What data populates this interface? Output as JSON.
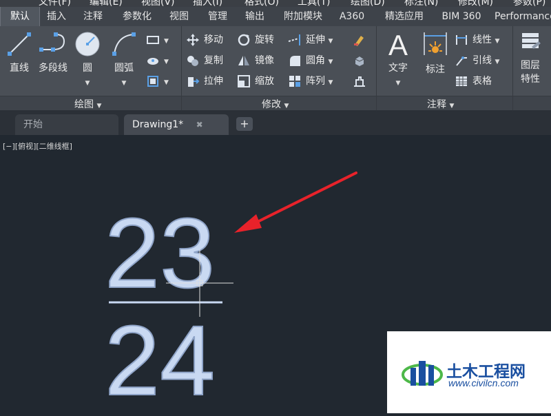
{
  "menu": {
    "items": [
      "文件(F)",
      "编辑(E)",
      "视图(V)",
      "插入(I)",
      "格式(O)",
      "工具(T)",
      "绘图(D)",
      "标注(N)",
      "修改(M)",
      "参数(P)"
    ]
  },
  "ribbon_tabs": {
    "items": [
      "默认",
      "插入",
      "注释",
      "参数化",
      "视图",
      "管理",
      "输出",
      "附加模块",
      "A360",
      "精选应用",
      "BIM 360",
      "Performance"
    ],
    "active": "默认"
  },
  "panels": {
    "draw": {
      "title": "绘图",
      "line": "直线",
      "polyline": "多段线",
      "circle": "圆",
      "arc": "圆弧"
    },
    "modify": {
      "title": "修改",
      "move": "移动",
      "rotate": "旋转",
      "trim": "延伸",
      "copy": "复制",
      "mirror": "镜像",
      "fillet": "圆角",
      "stretch": "拉伸",
      "scale": "缩放",
      "array": "阵列"
    },
    "annotation": {
      "title": "注释",
      "text": "文字",
      "dimension": "标注",
      "linear": "线性",
      "leader": "引线",
      "table": "表格"
    },
    "layers": {
      "layer_props_line1": "图层",
      "layer_props_line2": "特性"
    }
  },
  "file_tabs": {
    "items": [
      {
        "label": "开始",
        "active": false
      },
      {
        "label": "Drawing1*",
        "active": true
      }
    ],
    "add": "+"
  },
  "viewport": {
    "label": "[−][俯视][二维线框]",
    "numerator": "23",
    "denominator": "24"
  },
  "watermark": {
    "name": "土木工程网",
    "url": "www.civilcn.com"
  },
  "colors": {
    "accent_arrow": "#e8222a",
    "ribbon_bg": "#4a4f56",
    "viewport_bg": "#212830",
    "text_fill": "#c9d9f2"
  }
}
